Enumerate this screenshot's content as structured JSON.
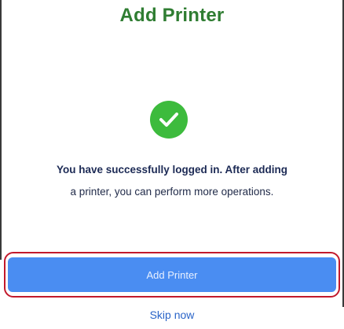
{
  "header": {
    "title": "Add Printer"
  },
  "status": {
    "icon": "check-icon",
    "icon_color": "#3dbb3d",
    "message_line1": "You have successfully logged in. After adding",
    "message_line2": "a printer, you can perform more operations."
  },
  "actions": {
    "primary_label": "Add Printer",
    "primary_color": "#4a8df2",
    "secondary_label": "Skip now",
    "highlight_color": "#c2192c"
  }
}
